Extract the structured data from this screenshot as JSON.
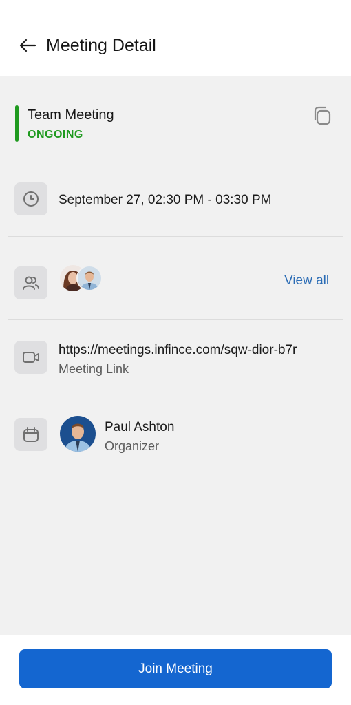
{
  "header": {
    "title": "Meeting Detail"
  },
  "meeting": {
    "title": "Team Meeting",
    "status": "ONGOING",
    "status_color": "#1f9a1f"
  },
  "schedule": {
    "datetime": "September 27, 02:30 PM - 03:30 PM"
  },
  "participants": {
    "view_all_label": "View all"
  },
  "link": {
    "url": "https://meetings.infince.com/sqw-dior-b7r",
    "label": "Meeting Link"
  },
  "organizer": {
    "name": "Paul Ashton",
    "role": "Organizer"
  },
  "footer": {
    "join_label": "Join Meeting"
  },
  "colors": {
    "accent": "#1466d0",
    "link": "#2b6cb5",
    "ongoing": "#1f9a1f"
  },
  "icons": [
    "arrow-left-icon",
    "copy-icon",
    "clock-icon",
    "people-icon",
    "video-icon",
    "calendar-icon"
  ]
}
